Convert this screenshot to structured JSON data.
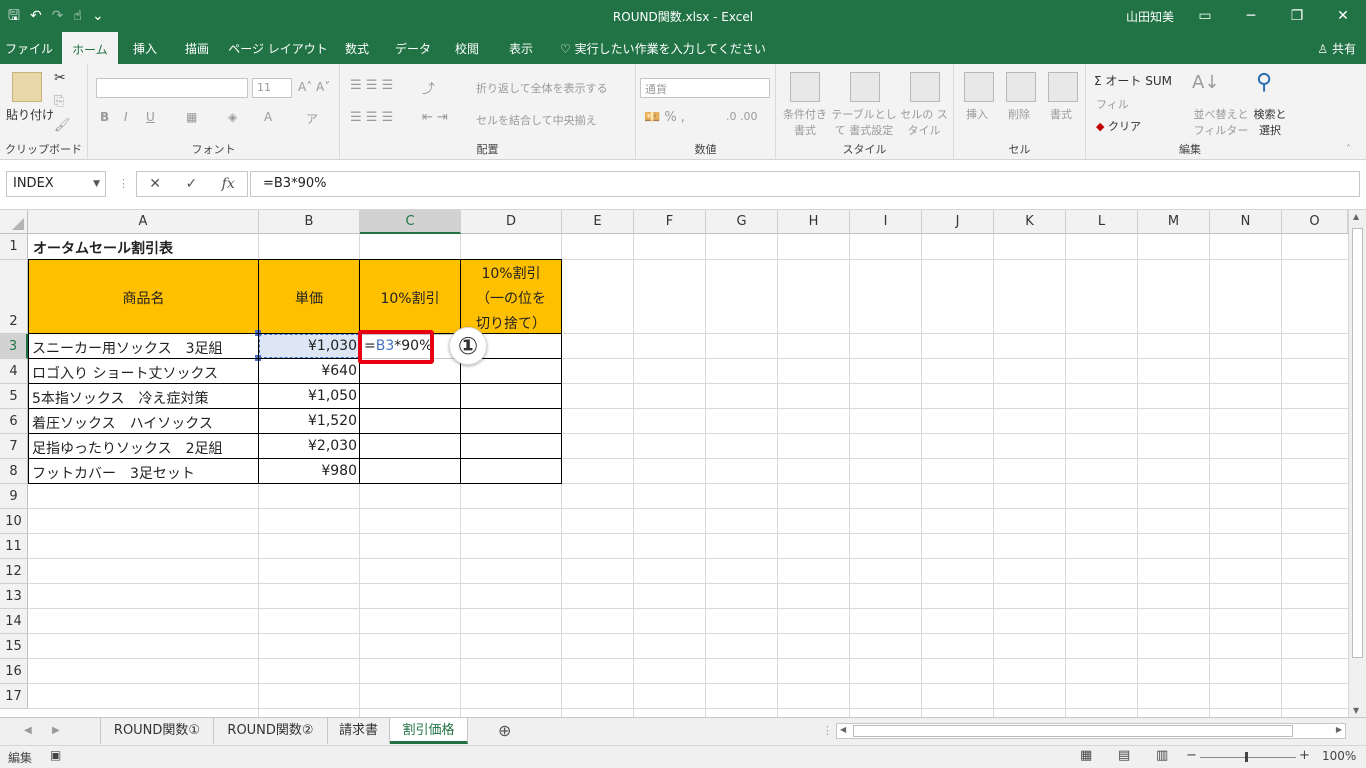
{
  "window": {
    "title": "ROUND関数.xlsx  -  Excel",
    "user": "山田知美",
    "controls": [
      "▭",
      "─",
      "❐",
      "✕"
    ]
  },
  "qat": {
    "save": "🖫",
    "undo": "↶",
    "redo": "↷",
    "touch": "☝",
    "more": "⌄"
  },
  "ribbon_tabs": [
    {
      "label": "ファイル",
      "active": false
    },
    {
      "label": "ホーム",
      "active": true
    },
    {
      "label": "挿入",
      "active": false
    },
    {
      "label": "描画",
      "active": false
    },
    {
      "label": "ページ レイアウト",
      "active": false
    },
    {
      "label": "数式",
      "active": false
    },
    {
      "label": "データ",
      "active": false
    },
    {
      "label": "校閲",
      "active": false
    },
    {
      "label": "表示",
      "active": false
    }
  ],
  "tell_me": "♡ 実行したい作業を入力してください",
  "share": "♙ 共有",
  "ribbon": {
    "clipboard": {
      "label": "クリップボード",
      "paste": "貼り付け"
    },
    "font": {
      "label": "フォント",
      "font_size": "11",
      "buttons": [
        "B",
        "I",
        "U"
      ]
    },
    "alignment": {
      "label": "配置",
      "wrap": "折り返して全体を表示する",
      "merge": "セルを結合して中央揃え"
    },
    "number": {
      "label": "数値",
      "format": "通貨"
    },
    "styles": {
      "label": "スタイル",
      "conditional": "条件付き 書式",
      "table": "テーブルとして 書式設定",
      "cell": "セルの スタイル"
    },
    "cells": {
      "label": "セル",
      "insert": "挿入",
      "delete": "削除",
      "format": "書式"
    },
    "editing": {
      "label": "編集",
      "autosum": "Σ オート SUM",
      "fill": "フィル",
      "clear": "クリア",
      "sort": "並べ替えと フィルター",
      "find": "検索と 選択"
    }
  },
  "formula_bar": {
    "name_box": "INDEX",
    "buttons": [
      "✕",
      "✓",
      "fx"
    ],
    "formula": "=B3*90%"
  },
  "columns": [
    "A",
    "B",
    "C",
    "D",
    "E",
    "F",
    "G",
    "H",
    "I",
    "J",
    "K",
    "L",
    "M",
    "N",
    "O"
  ],
  "rows": [
    "1",
    "2",
    "3",
    "4",
    "5",
    "6",
    "7",
    "8",
    "9",
    "10",
    "11",
    "12",
    "13",
    "14",
    "15",
    "16",
    "17"
  ],
  "sheet": {
    "title": "オータムセール割引表",
    "headers": {
      "a": "商品名",
      "b": "単価",
      "c": "10%割引",
      "d1": "10%割引",
      "d2": "（一の位を",
      "d3": "切り捨て）"
    },
    "items": [
      {
        "name": "スニーカー用ソックス　3足組",
        "price": "¥1,030"
      },
      {
        "name": "ロゴ入り ショート丈ソックス",
        "price": "¥640"
      },
      {
        "name": "5本指ソックス　冷え症対策",
        "price": "¥1,050"
      },
      {
        "name": "着圧ソックス　ハイソックス",
        "price": "¥1,520"
      },
      {
        "name": "足指ゆったりソックス　2足組",
        "price": "¥2,030"
      },
      {
        "name": "フットカバー　3足セット",
        "price": "¥980"
      }
    ],
    "editing_cell": {
      "prefix": "=",
      "ref": "B3",
      "rest": "*90%"
    },
    "callout": "①"
  },
  "sheet_tabs": [
    {
      "label": "ROUND関数①",
      "active": false
    },
    {
      "label": "ROUND関数②",
      "active": false
    },
    {
      "label": "請求書",
      "active": false
    },
    {
      "label": "割引価格",
      "active": true
    }
  ],
  "status": {
    "mode": "編集",
    "zoom": "100%"
  },
  "colors": {
    "brand": "#217346",
    "header_fill": "#ffc000",
    "ref_blue": "#4472c4",
    "callout_red": "#e60012"
  }
}
